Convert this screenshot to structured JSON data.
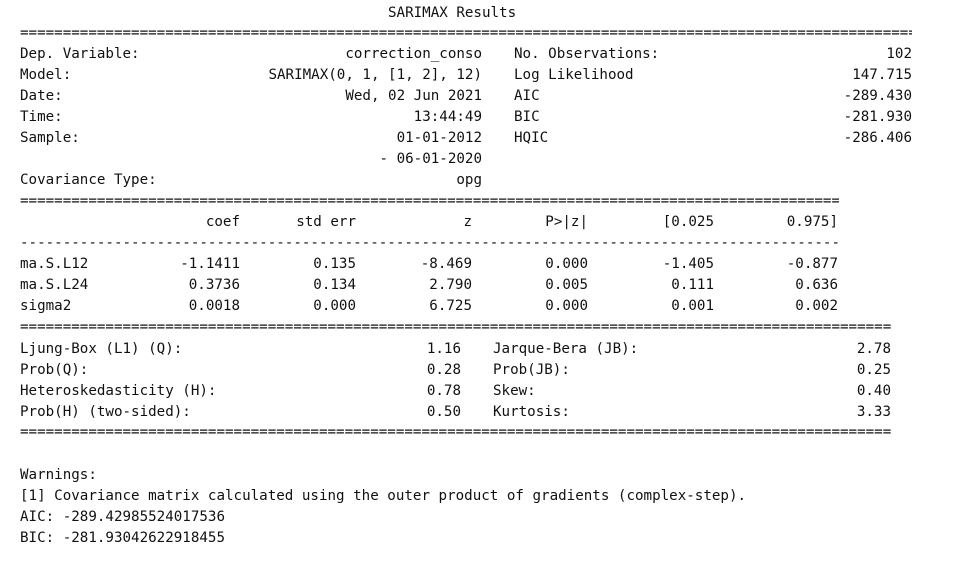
{
  "title": "SARIMAX Results",
  "summary": {
    "left": [
      {
        "label": "Dep. Variable:",
        "value": "correction_conso"
      },
      {
        "label": "Model:",
        "value": "SARIMAX(0, 1, [1, 2], 12)"
      },
      {
        "label": "Date:",
        "value": "Wed, 02 Jun 2021"
      },
      {
        "label": "Time:",
        "value": "13:44:49"
      },
      {
        "label": "Sample:",
        "value": "01-01-2012"
      },
      {
        "label": "",
        "value": "- 06-01-2020"
      },
      {
        "label": "Covariance Type:",
        "value": "opg"
      }
    ],
    "right": [
      {
        "label": "No. Observations:",
        "value": "102"
      },
      {
        "label": "Log Likelihood",
        "value": "147.715"
      },
      {
        "label": "AIC",
        "value": "-289.430"
      },
      {
        "label": "BIC",
        "value": "-281.930"
      },
      {
        "label": "HQIC",
        "value": "-286.406"
      }
    ]
  },
  "coef_table": {
    "headers": [
      "",
      "coef",
      "std err",
      "z",
      "P>|z|",
      "[0.025",
      "0.975]"
    ],
    "rows": [
      [
        "ma.S.L12",
        "-1.1411",
        "0.135",
        "-8.469",
        "0.000",
        "-1.405",
        "-0.877"
      ],
      [
        "ma.S.L24",
        "0.3736",
        "0.134",
        "2.790",
        "0.005",
        "0.111",
        "0.636"
      ],
      [
        "sigma2",
        "0.0018",
        "0.000",
        "6.725",
        "0.000",
        "0.001",
        "0.002"
      ]
    ]
  },
  "diagnostics": {
    "left": [
      {
        "label": "Ljung-Box (L1) (Q):",
        "value": "1.16"
      },
      {
        "label": "Prob(Q):",
        "value": "0.28"
      },
      {
        "label": "Heteroskedasticity (H):",
        "value": "0.78"
      },
      {
        "label": "Prob(H) (two-sided):",
        "value": "0.50"
      }
    ],
    "right": [
      {
        "label": "Jarque-Bera (JB):",
        "value": "2.78"
      },
      {
        "label": "Prob(JB):",
        "value": "0.25"
      },
      {
        "label": "Skew:",
        "value": "0.40"
      },
      {
        "label": "Kurtosis:",
        "value": "3.33"
      }
    ]
  },
  "warnings": {
    "heading": "Warnings:",
    "items": [
      "[1] Covariance matrix calculated using the outer product of gradients (complex-step)."
    ]
  },
  "extra": {
    "aic_line": "AIC: -289.42985524017536",
    "bic_line": "BIC: -281.93042622918455"
  }
}
